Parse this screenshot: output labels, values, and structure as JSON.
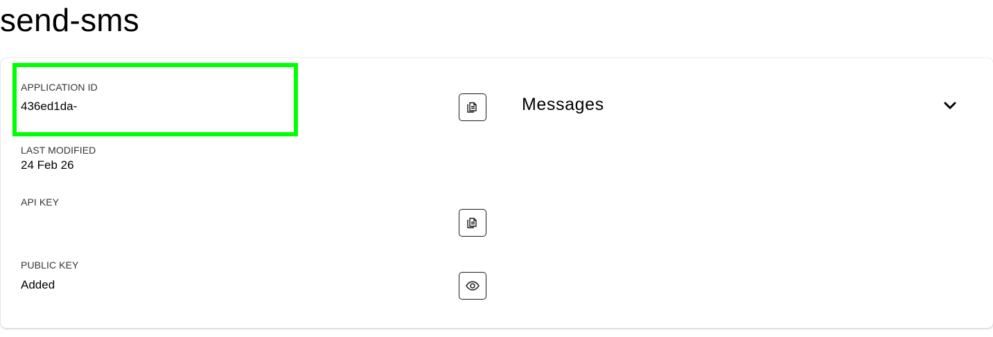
{
  "page": {
    "title": "send-sms"
  },
  "details": {
    "application_id": {
      "label": "APPLICATION ID",
      "value": "436ed1da-"
    },
    "last_modified": {
      "label": "LAST MODIFIED",
      "value": "24 Feb 26"
    },
    "api_key": {
      "label": "API KEY",
      "value": ""
    },
    "public_key": {
      "label": "PUBLIC KEY",
      "value": "Added"
    }
  },
  "actions": {
    "copy_application_id_icon": "copy-icon",
    "copy_api_key_icon": "copy-icon",
    "view_public_key_icon": "eye-icon"
  },
  "messages_section": {
    "title": "Messages",
    "toggle_icon": "chevron-down-icon"
  },
  "colors": {
    "highlight": "#00ff00",
    "text": "#000000",
    "label": "#333333"
  }
}
